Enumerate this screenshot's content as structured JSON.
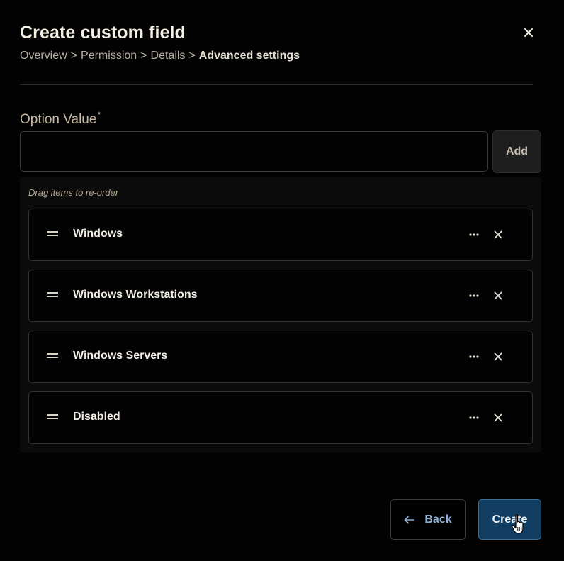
{
  "dialog": {
    "title": "Create custom field",
    "close_icon": "close-icon"
  },
  "breadcrumb": {
    "items": [
      "Overview",
      "Permission",
      "Details",
      "Advanced settings"
    ],
    "separator": ">"
  },
  "option_field": {
    "label": "Option Value",
    "required_marker": "*",
    "value": "",
    "placeholder": "",
    "add_label": "Add"
  },
  "options_list": {
    "hint": "Drag items to re-order",
    "items": [
      {
        "label": "Windows"
      },
      {
        "label": "Windows Workstations"
      },
      {
        "label": "Windows Servers"
      },
      {
        "label": "Disabled"
      }
    ],
    "icons": {
      "handle": "drag-handle-icon",
      "more": "more-horizontal-icon",
      "remove": "close-icon"
    }
  },
  "footer": {
    "back_label": "Back",
    "create_label": "Create",
    "back_icon": "arrow-left-icon"
  },
  "colors": {
    "background": "#020202",
    "accent_primary": "#123d63",
    "accent_link": "#8eb0d6"
  }
}
